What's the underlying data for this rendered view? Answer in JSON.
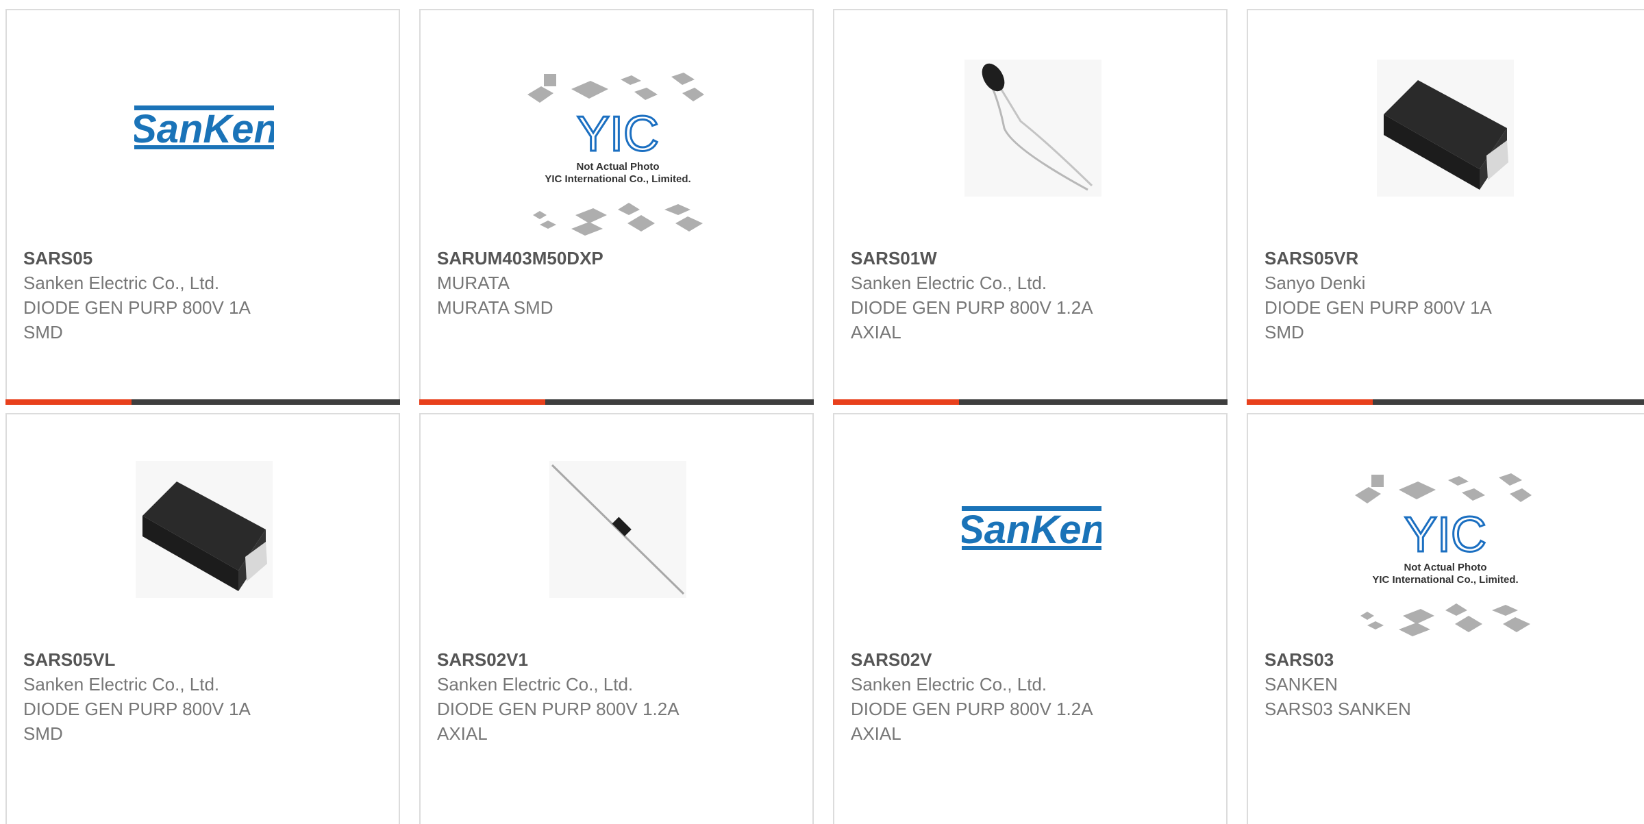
{
  "colors": {
    "accent": "#e8401c",
    "bar": "#3e3e3e",
    "border": "#dcdcdc",
    "sanken_blue": "#1a73b8",
    "yic_blue": "#1b6fc1"
  },
  "products": [
    {
      "part": "SARS05",
      "line1": "Sanken Electric Co., Ltd.",
      "line2": "DIODE GEN PURP 800V 1A",
      "line3": "SMD",
      "image": "sanken-logo"
    },
    {
      "part": "SARUM403M50DXP",
      "line1": "MURATA",
      "line2": "MURATA SMD",
      "line3": "",
      "image": "yic-placeholder"
    },
    {
      "part": "SARS01W",
      "line1": "Sanken Electric Co., Ltd.",
      "line2": "DIODE GEN PURP 800V 1.2A",
      "line3": "AXIAL",
      "image": "axial-diode-bent"
    },
    {
      "part": "SARS05VR",
      "line1": "Sanyo Denki",
      "line2": "DIODE GEN PURP 800V 1A",
      "line3": "SMD",
      "image": "smd-package"
    },
    {
      "part": "SARS05VL",
      "line1": "Sanken Electric Co., Ltd.",
      "line2": "DIODE GEN PURP 800V 1A",
      "line3": "SMD",
      "image": "smd-package"
    },
    {
      "part": "SARS02V1",
      "line1": "Sanken Electric Co., Ltd.",
      "line2": "DIODE GEN PURP 800V 1.2A",
      "line3": "AXIAL",
      "image": "axial-diode"
    },
    {
      "part": "SARS02V",
      "line1": "Sanken Electric Co., Ltd.",
      "line2": "DIODE GEN PURP 800V 1.2A",
      "line3": "AXIAL",
      "image": "sanken-logo"
    },
    {
      "part": "SARS03",
      "line1": "SANKEN",
      "line2": "SARS03 SANKEN",
      "line3": "",
      "image": "yic-placeholder"
    }
  ],
  "logos": {
    "sanken": "SanKen",
    "yic": "YIC",
    "yic_note1": "Not Actual Photo",
    "yic_note2": "YIC International Co., Limited."
  }
}
